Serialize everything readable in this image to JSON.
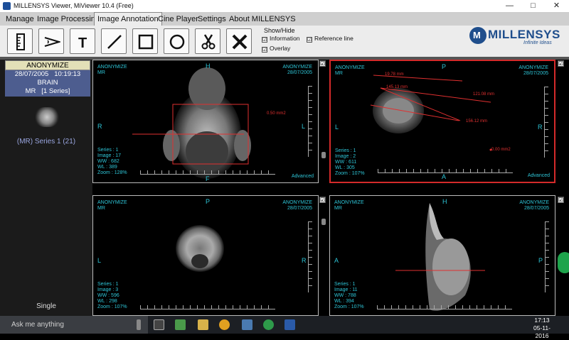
{
  "window": {
    "title": "MILLENSYS Viewer, MiViewer 10.4 (Free)",
    "minimize": "—",
    "maximize": "□",
    "close": "✕"
  },
  "menu": [
    "Manage",
    "Image Processing",
    "Image Annotation",
    "Cine Player",
    "Settings",
    "About MILLENSYS"
  ],
  "menu_active": "Image Annotation",
  "tools": [
    "ruler-tool",
    "freehand-tool",
    "text-tool",
    "line-tool",
    "rectangle-tool",
    "ellipse-tool",
    "cut-tool",
    "delete-tool"
  ],
  "show_hide": {
    "title": "Show/Hide",
    "information": "Information",
    "reference_line": "Reference line",
    "overlay": "Overlay",
    "check": "☑"
  },
  "logo": {
    "name": "MILLENSYS",
    "tagline": "Infinite Ideas"
  },
  "study": {
    "patient": "ANONYMIZE",
    "date": "28/07/2005",
    "time": "10:19:13",
    "description": "BRAIN",
    "modality": "MR",
    "series_count": "[1 Series]",
    "series_label": "(MR) Series 1 (21)"
  },
  "layout_label": "Single",
  "viewports": [
    {
      "name_tl": "ANONYMIZE",
      "mod": "MR",
      "name_tr": "ANONYMIZE",
      "date": "28/07/2005",
      "top": "H",
      "left": "R",
      "right": "L",
      "bottom": "F",
      "series": "Series : 1",
      "image": "Image : 17",
      "ww": "WW   : 682",
      "wl": "WL   : 389",
      "zoom": "Zoom : 128%",
      "advanced": "Advanced",
      "annotations": [
        "0.50 mm2"
      ]
    },
    {
      "name_tl": "ANONYMIZE",
      "mod": "MR",
      "name_tr": "ANONYMIZE",
      "date": "28/07/2005",
      "top": "P",
      "left": "L",
      "right": "R",
      "bottom": "A",
      "series": "Series : 1",
      "image": "Image : 2",
      "ww": "WW   : 611",
      "wl": "WL   : 305",
      "zoom": "Zoom : 107%",
      "advanced": "Advanced",
      "annotations": [
        "19.78 mm",
        "145.13 mm",
        "121.08 mm",
        "156.12 mm",
        "0.00 mm2"
      ]
    },
    {
      "name_tl": "ANONYMIZE",
      "mod": "MR",
      "name_tr": "ANONYMIZE",
      "date": "28/07/2005",
      "top": "P",
      "left": "L",
      "right": "R",
      "bottom": "",
      "series": "Series : 1",
      "image": "Image : 3",
      "ww": "WW   : 596",
      "wl": "WL   : 298",
      "zoom": "Zoom : 107%",
      "advanced": "",
      "annotations": []
    },
    {
      "name_tl": "ANONYMIZE",
      "mod": "MR",
      "name_tr": "ANONYMIZE",
      "date": "28/07/2005",
      "top": "H",
      "left": "A",
      "right": "P",
      "bottom": "",
      "series": "Series : 1",
      "image": "Image : 11",
      "ww": "WW   : 788",
      "wl": "WL   : 394",
      "zoom": "Zoom : 107%",
      "advanced": "",
      "annotations": []
    }
  ],
  "taskbar": {
    "search_placeholder": "Ask me anything",
    "time": "17:13",
    "date": "05-11-2016"
  },
  "colors": {
    "accent": "#2ec6d8",
    "annotation": "#e03030",
    "selected_border": "#d42a2a",
    "series_card": "#4d5d8f"
  }
}
